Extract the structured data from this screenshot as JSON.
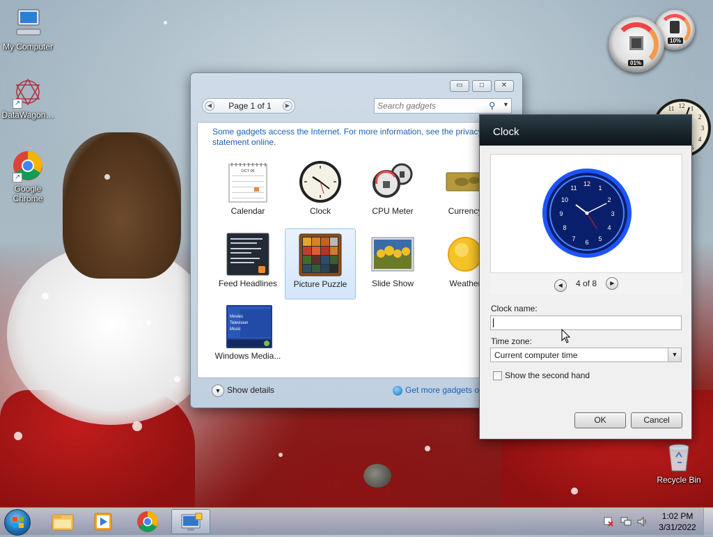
{
  "desktop": {
    "icons": [
      {
        "label": "My Computer",
        "icon": "computer-icon"
      },
      {
        "label": "DataWagon…",
        "icon": "datawagon-icon"
      },
      {
        "label": "Google Chrome",
        "icon": "chrome-icon"
      },
      {
        "label": "Recycle Bin",
        "icon": "recycle-bin-icon"
      }
    ],
    "cpu_meter": {
      "cpu": "01%",
      "memory": "10%"
    }
  },
  "gallery": {
    "page_label": "Page 1 of 1",
    "search_placeholder": "Search gadgets",
    "notice": "Some gadgets access the Internet.  For more information, see the privacy statement online.",
    "gadgets": [
      {
        "label": "Calendar",
        "icon": "calendar-icon",
        "calendar_month": "OCT 06"
      },
      {
        "label": "Clock",
        "icon": "clock-icon"
      },
      {
        "label": "CPU Meter",
        "icon": "cpu-meter-icon"
      },
      {
        "label": "Currency",
        "icon": "currency-icon"
      },
      {
        "label": "Feed Headlines",
        "icon": "feed-headlines-icon"
      },
      {
        "label": "Picture Puzzle",
        "icon": "picture-puzzle-icon",
        "selected": true
      },
      {
        "label": "Slide Show",
        "icon": "slide-show-icon"
      },
      {
        "label": "Weather",
        "icon": "weather-icon"
      },
      {
        "label": "Windows Media...",
        "icon": "windows-media-icon",
        "lines": [
          "Movies",
          "Television",
          "Music"
        ]
      }
    ],
    "show_details": "Show details",
    "get_more": "Get more gadgets online"
  },
  "clock_dialog": {
    "title": "Clock",
    "preview_counter": "4 of 8",
    "clock_name_label": "Clock name:",
    "clock_name_value": "",
    "time_zone_label": "Time zone:",
    "time_zone_value": "Current computer time",
    "second_hand_label": "Show the second hand",
    "second_hand_checked": false,
    "ok": "OK",
    "cancel": "Cancel"
  },
  "taskbar": {
    "time": "1:02 PM",
    "date": "3/31/2022",
    "pinned": [
      "file-explorer-icon",
      "media-player-icon",
      "chrome-icon",
      "gadgets-icon"
    ]
  },
  "colors": {
    "link": "#1a5fb4",
    "clock_neon": "#2255ff",
    "dialog_header": "#18232a"
  }
}
